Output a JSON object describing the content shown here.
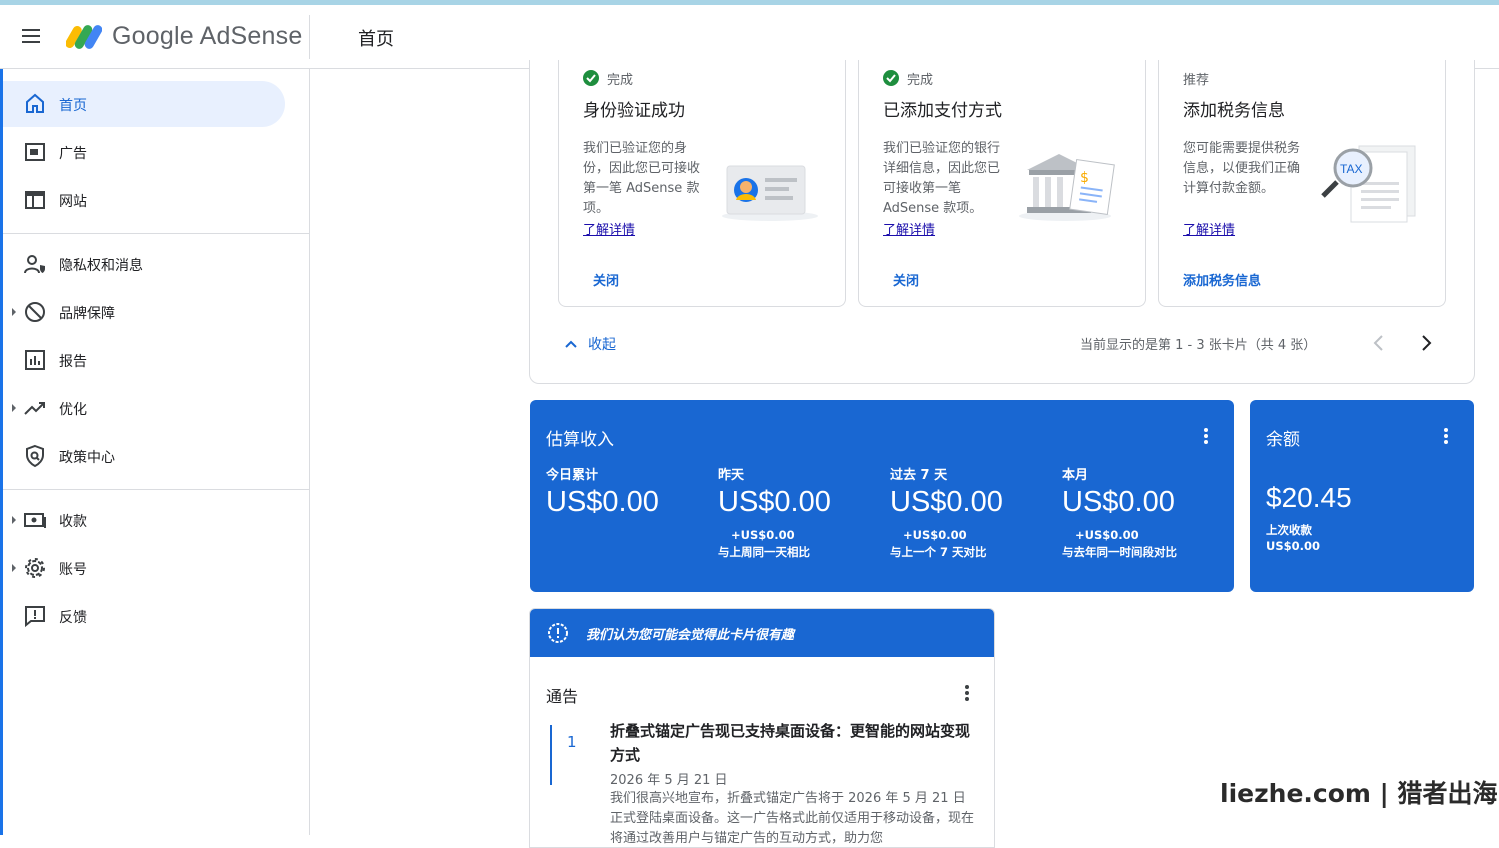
{
  "header": {
    "brand": "Google AdSense",
    "page_title": "首页",
    "menu_icon": "hamburger-menu-icon",
    "logo_icon": "adsense-logo-icon"
  },
  "sidebar": {
    "items": [
      {
        "label": "首页",
        "icon": "home-icon",
        "active": true
      },
      {
        "label": "广告",
        "icon": "ads-icon"
      },
      {
        "label": "网站",
        "icon": "sites-icon"
      },
      {
        "label": "隐私权和消息",
        "icon": "privacy-icon"
      },
      {
        "label": "品牌保障",
        "icon": "block-icon"
      },
      {
        "label": "报告",
        "icon": "report-icon"
      },
      {
        "label": "优化",
        "icon": "trend-icon"
      },
      {
        "label": "政策中心",
        "icon": "shield-icon"
      },
      {
        "label": "收款",
        "icon": "payments-icon"
      },
      {
        "label": "账号",
        "icon": "gear-icon"
      },
      {
        "label": "反馈",
        "icon": "feedback-icon"
      }
    ]
  },
  "tasks": {
    "cards": [
      {
        "status": "完成",
        "title": "身份验证成功",
        "desc": "我们已验证您的身份，因此您已可接收第一笔 AdSense 款项。",
        "learn": "了解详情",
        "action": "关闭",
        "illustration": "id-card-illustration"
      },
      {
        "status": "完成",
        "title": "已添加支付方式",
        "desc": "我们已验证您的银行详细信息，因此您已可接收第一笔 AdSense 款项。",
        "learn": "了解详情",
        "action": "关闭",
        "illustration": "bank-illustration"
      },
      {
        "status": "推荐",
        "title": "添加税务信息",
        "desc": "您可能需要提供税务信息，以便我们正确计算付款金额。",
        "learn": "了解详情",
        "action": "添加税务信息",
        "illustration": "tax-illustration",
        "tax_text": "TAX"
      }
    ],
    "collapse": "收起",
    "pager": "当前显示的是第 1 - 3 张卡片（共 4 张）"
  },
  "earnings": {
    "title": "估算收入",
    "metrics": [
      {
        "label": "今日累计",
        "value": "US$0.00",
        "delta": "",
        "compare": ""
      },
      {
        "label": "昨天",
        "value": "US$0.00",
        "delta": "+US$0.00",
        "compare": "与上周同一天相比"
      },
      {
        "label": "过去 7 天",
        "value": "US$0.00",
        "delta": "+US$0.00",
        "compare": "与上一个 7 天对比"
      },
      {
        "label": "本月",
        "value": "US$0.00",
        "delta": "+US$0.00",
        "compare": "与去年同一时间段对比"
      }
    ]
  },
  "balance": {
    "title": "余额",
    "value": "$20.45",
    "last_payment_label": "上次收款",
    "last_payment_value": "US$0.00"
  },
  "notice": {
    "banner": "我们认为您可能会觉得此卡片很有趣",
    "title": "通告",
    "number": "1",
    "headline": "折叠式锚定广告现已支持桌面设备：更智能的网站变现方式",
    "date": "2026 年 5 月 21 日",
    "body": "我们很高兴地宣布，折叠式锚定广告将于 2026 年 5 月 21 日正式登陆桌面设备。这一广告格式此前仅适用于移动设备，现在将通过改善用户与锚定广告的互动方式，助力您"
  },
  "watermark": "liezhe.com | 猎者出海",
  "colors": {
    "accent": "#1967d2",
    "active_bg": "#e8f0fe",
    "success": "#1e8e3e"
  }
}
